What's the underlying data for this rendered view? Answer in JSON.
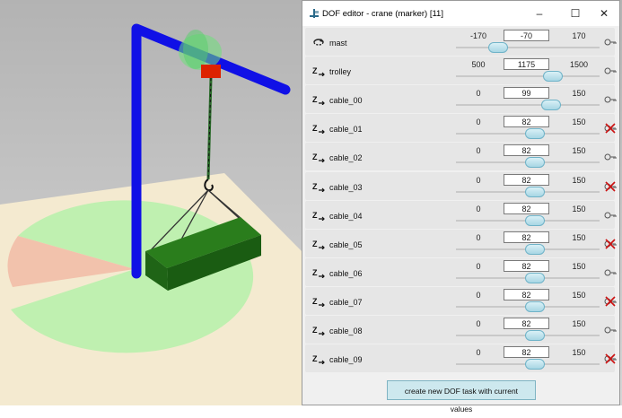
{
  "window": {
    "title": "DOF editor - crane (marker) [11]"
  },
  "rows": [
    {
      "name": "mast",
      "min": "-170",
      "value": "-70",
      "max": "170",
      "fraction": 0.295,
      "locked": false,
      "icon": "rotation-icon"
    },
    {
      "name": "trolley",
      "min": "500",
      "value": "1175",
      "max": "1500",
      "fraction": 0.675,
      "locked": false,
      "icon": "translation-z-icon"
    },
    {
      "name": "cable_00",
      "min": "0",
      "value": "99",
      "max": "150",
      "fraction": 0.66,
      "locked": false,
      "icon": "translation-z-icon"
    },
    {
      "name": "cable_01",
      "min": "0",
      "value": "82",
      "max": "150",
      "fraction": 0.547,
      "locked": true,
      "icon": "translation-z-icon"
    },
    {
      "name": "cable_02",
      "min": "0",
      "value": "82",
      "max": "150",
      "fraction": 0.547,
      "locked": false,
      "icon": "translation-z-icon"
    },
    {
      "name": "cable_03",
      "min": "0",
      "value": "82",
      "max": "150",
      "fraction": 0.547,
      "locked": true,
      "icon": "translation-z-icon"
    },
    {
      "name": "cable_04",
      "min": "0",
      "value": "82",
      "max": "150",
      "fraction": 0.547,
      "locked": false,
      "icon": "translation-z-icon"
    },
    {
      "name": "cable_05",
      "min": "0",
      "value": "82",
      "max": "150",
      "fraction": 0.547,
      "locked": true,
      "icon": "translation-z-icon"
    },
    {
      "name": "cable_06",
      "min": "0",
      "value": "82",
      "max": "150",
      "fraction": 0.547,
      "locked": false,
      "icon": "translation-z-icon"
    },
    {
      "name": "cable_07",
      "min": "0",
      "value": "82",
      "max": "150",
      "fraction": 0.547,
      "locked": true,
      "icon": "translation-z-icon"
    },
    {
      "name": "cable_08",
      "min": "0",
      "value": "82",
      "max": "150",
      "fraction": 0.547,
      "locked": false,
      "icon": "translation-z-icon"
    },
    {
      "name": "cable_09",
      "min": "0",
      "value": "82",
      "max": "150",
      "fraction": 0.547,
      "locked": true,
      "icon": "translation-z-icon"
    }
  ],
  "footer": {
    "button_label": "create new DOF task with current values"
  },
  "colors": {
    "mast": "#1010e6",
    "load": "#1a5c12",
    "trolley": "#dd2200",
    "thumb": "#a8d6e4",
    "lock_red": "#cc1111"
  }
}
